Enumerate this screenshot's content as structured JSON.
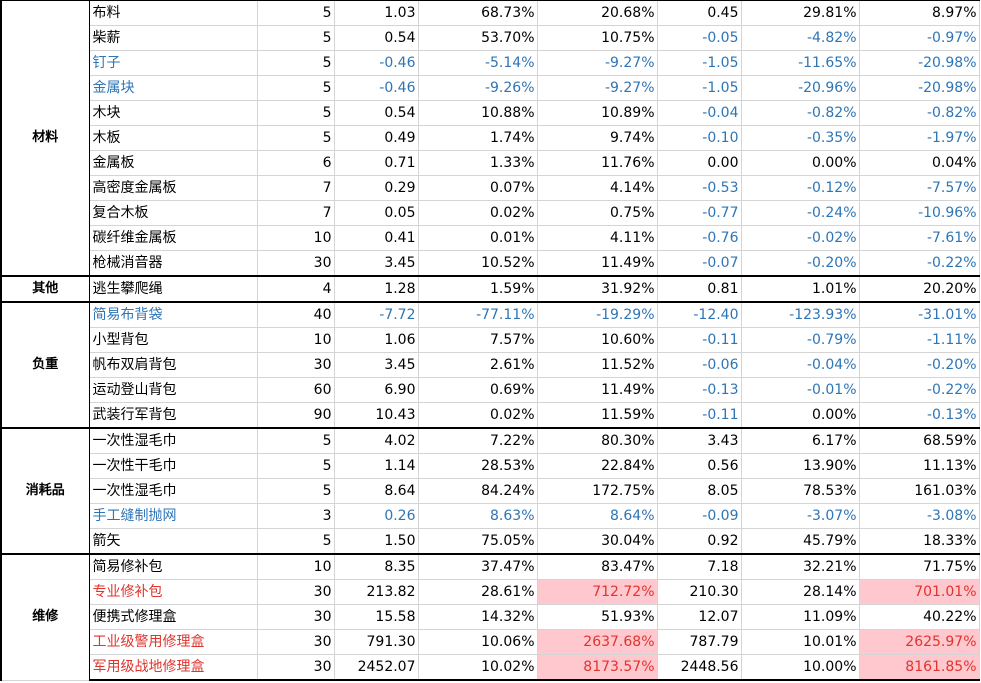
{
  "colors": {
    "negative": "#2e75b6",
    "alert": "#e0342e",
    "highlight": "#ffc7ce"
  },
  "groups": [
    {
      "label": "材料",
      "rows": [
        {
          "name": "布料",
          "style": "normal",
          "values": [
            "5",
            "1.03",
            "68.73%",
            "20.68%",
            "0.45",
            "29.81%",
            "8.97%"
          ]
        },
        {
          "name": "柴薪",
          "style": "normal",
          "values": [
            "5",
            "0.54",
            "53.70%",
            "10.75%",
            "-0.05",
            "-4.82%",
            "-0.97%"
          ]
        },
        {
          "name": "钉子",
          "style": "blue",
          "values": [
            "5",
            "-0.46",
            "-5.14%",
            "-9.27%",
            "-1.05",
            "-11.65%",
            "-20.98%"
          ]
        },
        {
          "name": "金属块",
          "style": "blue",
          "values": [
            "5",
            "-0.46",
            "-9.26%",
            "-9.27%",
            "-1.05",
            "-20.96%",
            "-20.98%"
          ]
        },
        {
          "name": "木块",
          "style": "normal",
          "values": [
            "5",
            "0.54",
            "10.88%",
            "10.89%",
            "-0.04",
            "-0.82%",
            "-0.82%"
          ]
        },
        {
          "name": "木板",
          "style": "normal",
          "values": [
            "5",
            "0.49",
            "1.74%",
            "9.74%",
            "-0.10",
            "-0.35%",
            "-1.97%"
          ]
        },
        {
          "name": "金属板",
          "style": "normal",
          "values": [
            "6",
            "0.71",
            "1.33%",
            "11.76%",
            "0.00",
            "0.00%",
            "0.04%"
          ]
        },
        {
          "name": "高密度金属板",
          "style": "normal",
          "values": [
            "7",
            "0.29",
            "0.07%",
            "4.14%",
            "-0.53",
            "-0.12%",
            "-7.57%"
          ]
        },
        {
          "name": "复合木板",
          "style": "normal",
          "values": [
            "7",
            "0.05",
            "0.02%",
            "0.75%",
            "-0.77",
            "-0.24%",
            "-10.96%"
          ]
        },
        {
          "name": "碳纤维金属板",
          "style": "normal",
          "values": [
            "10",
            "0.41",
            "0.01%",
            "4.11%",
            "-0.76",
            "-0.02%",
            "-7.61%"
          ]
        },
        {
          "name": "枪械消音器",
          "style": "normal",
          "values": [
            "30",
            "3.45",
            "10.52%",
            "11.49%",
            "-0.07",
            "-0.20%",
            "-0.22%"
          ]
        }
      ]
    },
    {
      "label": "其他",
      "rows": [
        {
          "name": "逃生攀爬绳",
          "style": "normal",
          "values": [
            "4",
            "1.28",
            "1.59%",
            "31.92%",
            "0.81",
            "1.01%",
            "20.20%"
          ]
        }
      ]
    },
    {
      "label": "负重",
      "rows": [
        {
          "name": "简易布背袋",
          "style": "blue",
          "values": [
            "40",
            "-7.72",
            "-77.11%",
            "-19.29%",
            "-12.40",
            "-123.93%",
            "-31.01%"
          ]
        },
        {
          "name": "小型背包",
          "style": "normal",
          "values": [
            "10",
            "1.06",
            "7.57%",
            "10.60%",
            "-0.11",
            "-0.79%",
            "-1.11%"
          ]
        },
        {
          "name": "帆布双肩背包",
          "style": "normal",
          "values": [
            "30",
            "3.45",
            "2.61%",
            "11.52%",
            "-0.06",
            "-0.04%",
            "-0.20%"
          ]
        },
        {
          "name": "运动登山背包",
          "style": "normal",
          "values": [
            "60",
            "6.90",
            "0.69%",
            "11.49%",
            "-0.13",
            "-0.01%",
            "-0.22%"
          ]
        },
        {
          "name": "武装行军背包",
          "style": "normal",
          "values": [
            "90",
            "10.43",
            "0.02%",
            "11.59%",
            "-0.11",
            "0.00%",
            "-0.13%"
          ]
        }
      ]
    },
    {
      "label": "消耗品",
      "rows": [
        {
          "name": "一次性湿毛巾",
          "style": "normal",
          "values": [
            "5",
            "4.02",
            "7.22%",
            "80.30%",
            "3.43",
            "6.17%",
            "68.59%"
          ]
        },
        {
          "name": "一次性干毛巾",
          "style": "normal",
          "values": [
            "5",
            "1.14",
            "28.53%",
            "22.84%",
            "0.56",
            "13.90%",
            "11.13%"
          ]
        },
        {
          "name": "一次性湿毛巾",
          "style": "normal",
          "values": [
            "5",
            "8.64",
            "84.24%",
            "172.75%",
            "8.05",
            "78.53%",
            "161.03%"
          ]
        },
        {
          "name": "手工缝制抛网",
          "style": "blue",
          "values": [
            "3",
            "0.26",
            "8.63%",
            "8.64%",
            "-0.09",
            "-3.07%",
            "-3.08%"
          ]
        },
        {
          "name": "箭矢",
          "style": "normal",
          "values": [
            "5",
            "1.50",
            "75.05%",
            "30.04%",
            "0.92",
            "45.79%",
            "18.33%"
          ]
        }
      ]
    },
    {
      "label": "维修",
      "rows": [
        {
          "name": "简易修补包",
          "style": "normal",
          "values": [
            "10",
            "8.35",
            "37.47%",
            "83.47%",
            "7.18",
            "32.21%",
            "71.75%"
          ]
        },
        {
          "name": "专业修补包",
          "style": "red",
          "values": [
            "30",
            "213.82",
            "28.61%",
            "712.72%",
            "210.30",
            "28.14%",
            "701.01%"
          ]
        },
        {
          "name": "便携式修理盒",
          "style": "normal",
          "values": [
            "30",
            "15.58",
            "14.32%",
            "51.93%",
            "12.07",
            "11.09%",
            "40.22%"
          ]
        },
        {
          "name": "工业级警用修理盒",
          "style": "red",
          "values": [
            "30",
            "791.30",
            "10.06%",
            "2637.68%",
            "787.79",
            "10.01%",
            "2625.97%"
          ]
        },
        {
          "name": "军用级战地修理盒",
          "style": "red",
          "values": [
            "30",
            "2452.07",
            "10.02%",
            "8173.57%",
            "2448.56",
            "10.00%",
            "8161.85%"
          ]
        }
      ]
    }
  ]
}
